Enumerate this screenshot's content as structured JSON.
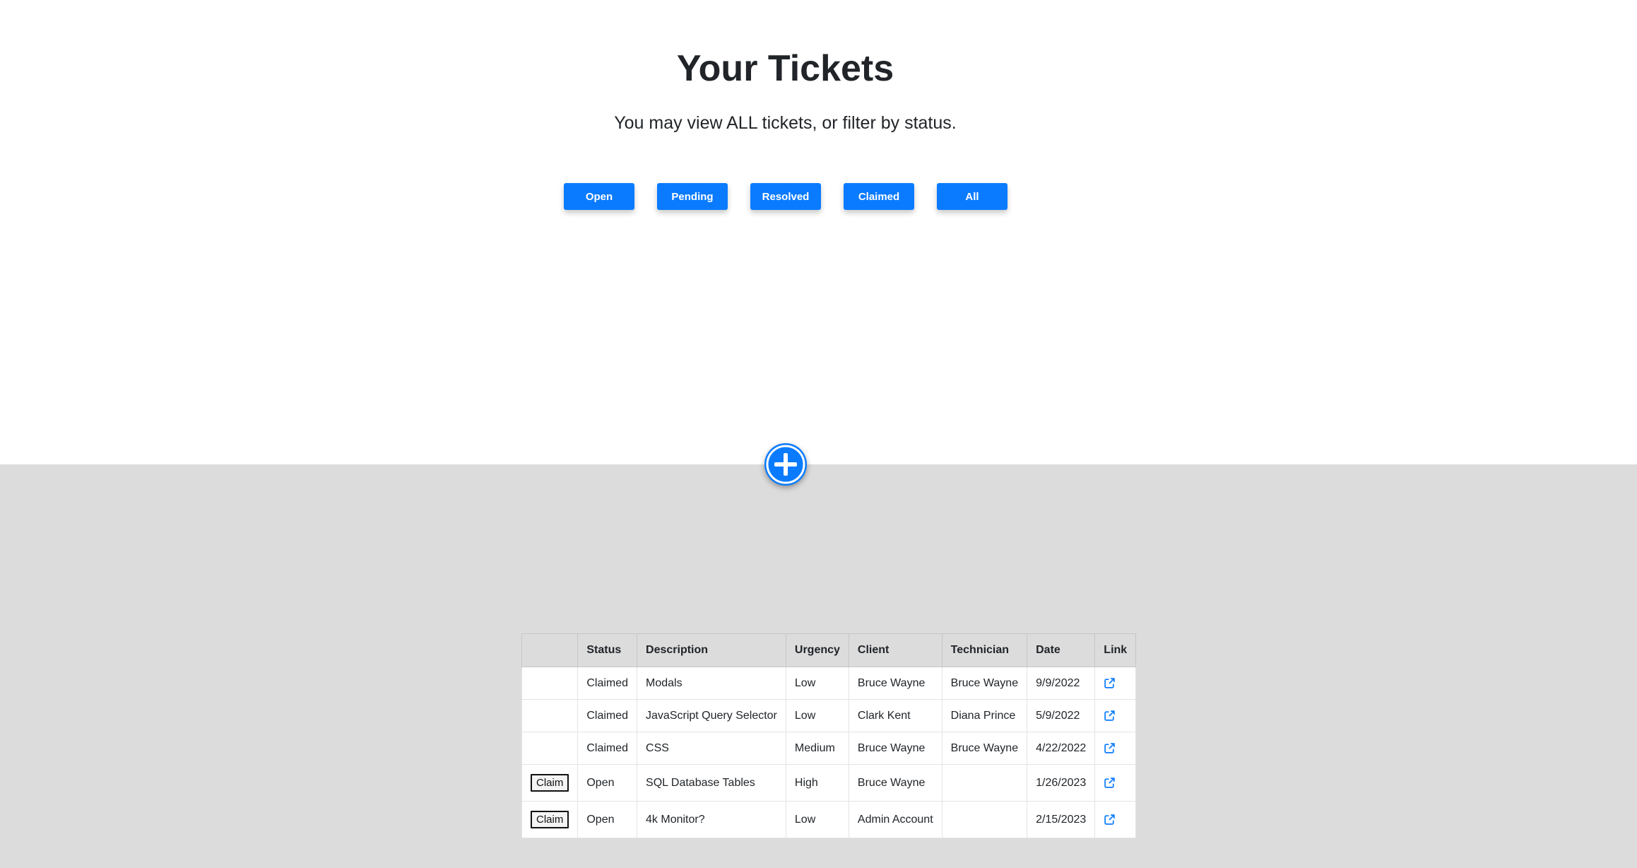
{
  "header": {
    "title": "Your Tickets",
    "subtitle": "You may view ALL tickets, or filter by status."
  },
  "filters": [
    {
      "label": "Open"
    },
    {
      "label": "Pending"
    },
    {
      "label": "Resolved"
    },
    {
      "label": "Claimed"
    },
    {
      "label": "All"
    }
  ],
  "add_button": {
    "icon": "plus-circle-icon"
  },
  "colors": {
    "accent": "#0a7bff",
    "lower_background": "#dcdcdd",
    "header_row": "#dcdcdd"
  },
  "table": {
    "columns": [
      "",
      "Status",
      "Description",
      "Urgency",
      "Client",
      "Technician",
      "Date",
      "Link"
    ],
    "claim_label": "Claim",
    "link_icon": "external-link-icon",
    "rows": [
      {
        "claim": "",
        "status": "Claimed",
        "description": "Modals",
        "urgency": "Low",
        "client": "Bruce Wayne",
        "technician": "Bruce Wayne",
        "date": "9/9/2022"
      },
      {
        "claim": "",
        "status": "Claimed",
        "description": "JavaScript Query Selector",
        "urgency": "Low",
        "client": "Clark Kent",
        "technician": "Diana Prince",
        "date": "5/9/2022"
      },
      {
        "claim": "",
        "status": "Claimed",
        "description": "CSS",
        "urgency": "Medium",
        "client": "Bruce Wayne",
        "technician": "Bruce Wayne",
        "date": "4/22/2022"
      },
      {
        "claim": "Claim",
        "status": "Open",
        "description": "SQL Database Tables",
        "urgency": "High",
        "client": "Bruce Wayne",
        "technician": "",
        "date": "1/26/2023"
      },
      {
        "claim": "Claim",
        "status": "Open",
        "description": "4k Monitor?",
        "urgency": "Low",
        "client": "Admin Account",
        "technician": "",
        "date": "2/15/2023"
      }
    ]
  }
}
